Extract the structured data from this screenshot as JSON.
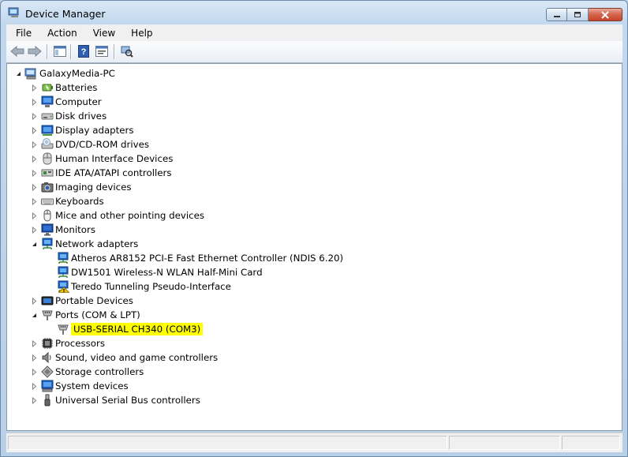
{
  "window": {
    "title": "Device Manager"
  },
  "menu": [
    "File",
    "Action",
    "View",
    "Help"
  ],
  "toolbar": {
    "buttons": [
      {
        "name": "back-arrow-icon"
      },
      {
        "name": "forward-arrow-icon"
      },
      {
        "name": "show-hide-console-tree-icon"
      },
      {
        "name": "help-icon"
      },
      {
        "name": "properties-icon"
      },
      {
        "name": "scan-hardware-changes-icon"
      }
    ]
  },
  "tree": {
    "root": {
      "label": "GalaxyMedia-PC",
      "icon": "computer-root-icon"
    },
    "categories": [
      {
        "label": "Batteries",
        "icon": "battery-icon",
        "expanded": false
      },
      {
        "label": "Computer",
        "icon": "computer-icon",
        "expanded": false
      },
      {
        "label": "Disk drives",
        "icon": "disk-drive-icon",
        "expanded": false
      },
      {
        "label": "Display adapters",
        "icon": "display-adapter-icon",
        "expanded": false
      },
      {
        "label": "DVD/CD-ROM drives",
        "icon": "dvd-drive-icon",
        "expanded": false
      },
      {
        "label": "Human Interface Devices",
        "icon": "hid-icon",
        "expanded": false
      },
      {
        "label": "IDE ATA/ATAPI controllers",
        "icon": "ide-controller-icon",
        "expanded": false
      },
      {
        "label": "Imaging devices",
        "icon": "camera-icon",
        "expanded": false
      },
      {
        "label": "Keyboards",
        "icon": "keyboard-icon",
        "expanded": false
      },
      {
        "label": "Mice and other pointing devices",
        "icon": "mouse-icon",
        "expanded": false
      },
      {
        "label": "Monitors",
        "icon": "monitor-icon",
        "expanded": false
      },
      {
        "label": "Network adapters",
        "icon": "network-adapter-icon",
        "expanded": true,
        "children": [
          {
            "label": "Atheros AR8152 PCI-E Fast Ethernet Controller (NDIS 6.20)",
            "icon": "network-adapter-icon",
            "warning": false
          },
          {
            "label": "DW1501 Wireless-N WLAN Half-Mini Card",
            "icon": "network-adapter-icon",
            "warning": false
          },
          {
            "label": "Teredo Tunneling Pseudo-Interface",
            "icon": "network-adapter-icon",
            "warning": true
          }
        ]
      },
      {
        "label": "Portable Devices",
        "icon": "portable-device-icon",
        "expanded": false
      },
      {
        "label": "Ports (COM & LPT)",
        "icon": "port-icon",
        "expanded": true,
        "children": [
          {
            "label": "USB-SERIAL CH340 (COM3)",
            "icon": "port-icon",
            "warning": false,
            "highlighted": true
          }
        ]
      },
      {
        "label": "Processors",
        "icon": "processor-icon",
        "expanded": false
      },
      {
        "label": "Sound, video and game controllers",
        "icon": "sound-icon",
        "expanded": false
      },
      {
        "label": "Storage controllers",
        "icon": "storage-controller-icon",
        "expanded": false
      },
      {
        "label": "System devices",
        "icon": "system-device-icon",
        "expanded": false
      },
      {
        "label": "Universal Serial Bus controllers",
        "icon": "usb-icon",
        "expanded": false
      }
    ]
  },
  "colors": {
    "highlight": "#ffff00",
    "accent": "#1e5fb4",
    "warning": "#f2c200"
  }
}
